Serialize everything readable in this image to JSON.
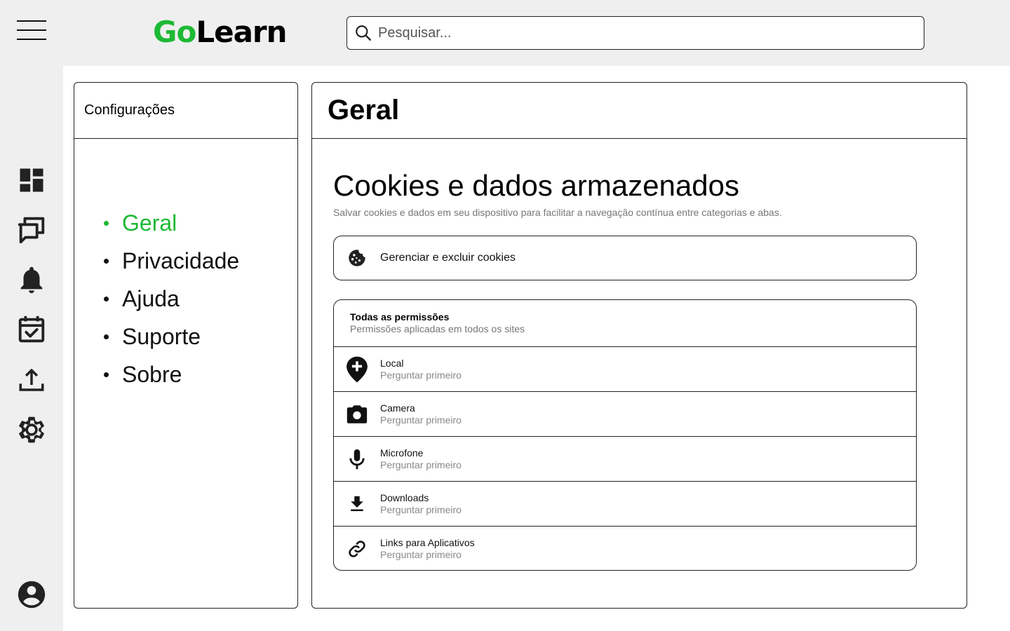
{
  "brand": {
    "logo_go": "Go",
    "logo_learn": "Learn",
    "accent_color": "#1db934"
  },
  "search": {
    "placeholder": "Pesquisar..."
  },
  "rail": {
    "icons": [
      "dashboard-icon",
      "chat-icon",
      "notifications-icon",
      "calendar-check-icon",
      "upload-icon",
      "settings-icon"
    ],
    "profile_icon": "account-icon"
  },
  "settings": {
    "title": "Configurações",
    "items": [
      {
        "label": "Geral",
        "active": true
      },
      {
        "label": "Privacidade",
        "active": false
      },
      {
        "label": "Ajuda",
        "active": false
      },
      {
        "label": "Suporte",
        "active": false
      },
      {
        "label": "Sobre",
        "active": false
      }
    ]
  },
  "main": {
    "title": "Geral",
    "section_title": "Cookies e dados armazenados",
    "section_desc": "Salvar cookies e dados em seu dispositivo para facilitar a navegação contínua entre categorias e abas.",
    "cookies_button": {
      "label": "Gerenciar e excluir cookies",
      "icon": "cookie-icon"
    },
    "permissions": {
      "title": "Todas as permissões",
      "subtitle": "Permissões aplicadas em todos os sites",
      "items": [
        {
          "name": "Local",
          "value": "Perguntar primeiro",
          "icon": "location-icon"
        },
        {
          "name": "Camera",
          "value": "Perguntar primeiro",
          "icon": "camera-icon"
        },
        {
          "name": "Microfone",
          "value": "Perguntar primeiro",
          "icon": "microphone-icon"
        },
        {
          "name": "Downloads",
          "value": "Perguntar primeiro",
          "icon": "download-icon"
        },
        {
          "name": "Links para Aplicativos",
          "value": "Perguntar primeiro",
          "icon": "link-icon"
        }
      ]
    }
  }
}
